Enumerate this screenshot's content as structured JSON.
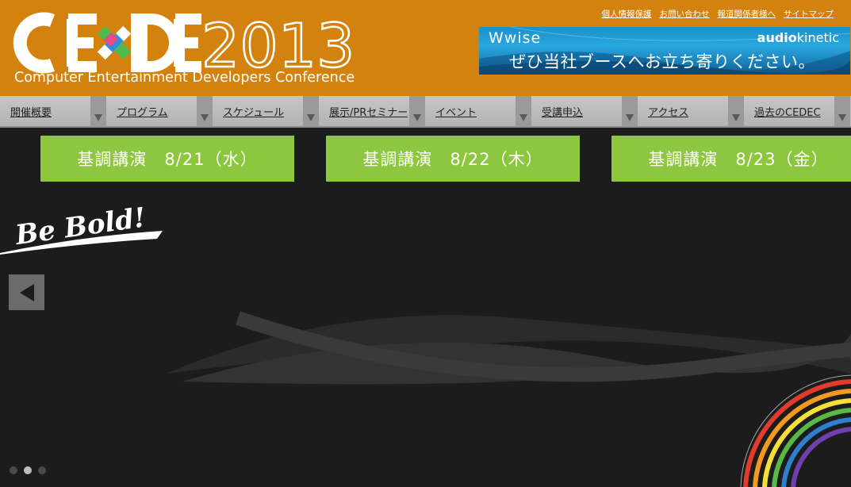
{
  "header": {
    "logo_letters": "CEDEC",
    "logo_year": "2013",
    "logo_subtitle": "Computer Entertainment Developers Conference",
    "utility_links": [
      "個人情報保護",
      "お問い合わせ",
      "報道関係者様へ",
      "サイトマップ"
    ]
  },
  "banner": {
    "brand": "Wwise",
    "logo_a": "audio",
    "logo_b": "kinetic",
    "message": "ぜひ当社ブースへお立ち寄りください。"
  },
  "nav": {
    "items": [
      {
        "label": "開催概要"
      },
      {
        "label": "プログラム"
      },
      {
        "label": "スケジュール"
      },
      {
        "label": "展示/PRセミナー"
      },
      {
        "label": "イベント"
      },
      {
        "label": "受講申込"
      },
      {
        "label": "アクセス"
      },
      {
        "label": "過去のCEDEC"
      }
    ]
  },
  "keynotes": [
    {
      "label": "基調講演　8/21（水）"
    },
    {
      "label": "基調講演　8/22（木）"
    },
    {
      "label": "基調講演　8/23（金）"
    }
  ],
  "hero": {
    "tagline": "Be Bold!"
  },
  "carousel": {
    "slide_count": 3,
    "active_index": 1
  },
  "colors": {
    "header_bg": "#d3820d",
    "keynote_green": "#8dc63f",
    "main_bg": "#1c1c1c",
    "nav_bg": "#bdbdbd"
  }
}
